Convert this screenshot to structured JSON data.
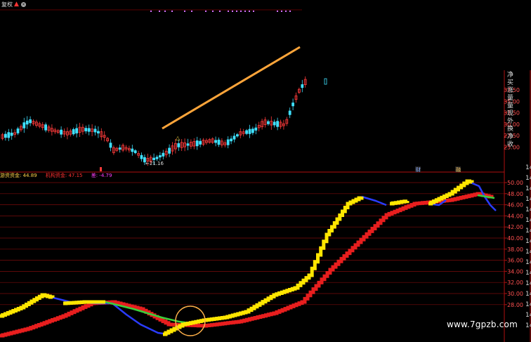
{
  "toolbar": {
    "label": "复权",
    "up_arrow_icon": "up-arrow-icon",
    "close_icon": "close-icon"
  },
  "price_panel": {
    "axis_ticks": [
      "37.50",
      "35.00",
      "32.50",
      "30.00",
      "27.50",
      "25.00"
    ],
    "low_label": "21.16",
    "right_chars": [
      "净",
      "买",
      "涨",
      "量",
      "量",
      "现",
      "外",
      "换",
      "净",
      "收"
    ],
    "markers": [
      "财",
      "融"
    ]
  },
  "indicator_panel": {
    "legend": {
      "retail": "游资资金: 44.89",
      "institution": "机构资金: 47.15",
      "diff": "差: -4.79"
    },
    "axis_ticks": [
      "50.00",
      "48.00",
      "46.00",
      "44.00",
      "42.00",
      "40.00",
      "38.00",
      "36.00",
      "34.00",
      "32.00",
      "30.00",
      "28.00"
    ],
    "right_digits": [
      "14",
      "14",
      "14",
      "14",
      "14",
      "14",
      "14",
      "14",
      "14",
      "14",
      "14",
      "14",
      "14",
      "14",
      "14",
      "14"
    ]
  },
  "colors": {
    "yellow_line": "#ffe600",
    "red_line": "#e81e1e",
    "blue_line": "#2a3cff",
    "green_line": "#3ccf3c",
    "trend_line": "#ffa53a",
    "candle_up": "#ff3b3b",
    "candle_down": "#3fe0ff",
    "grid": "#7a0a0a",
    "circle": "#ffb14a"
  },
  "watermark": "www.7gpzb.com"
}
